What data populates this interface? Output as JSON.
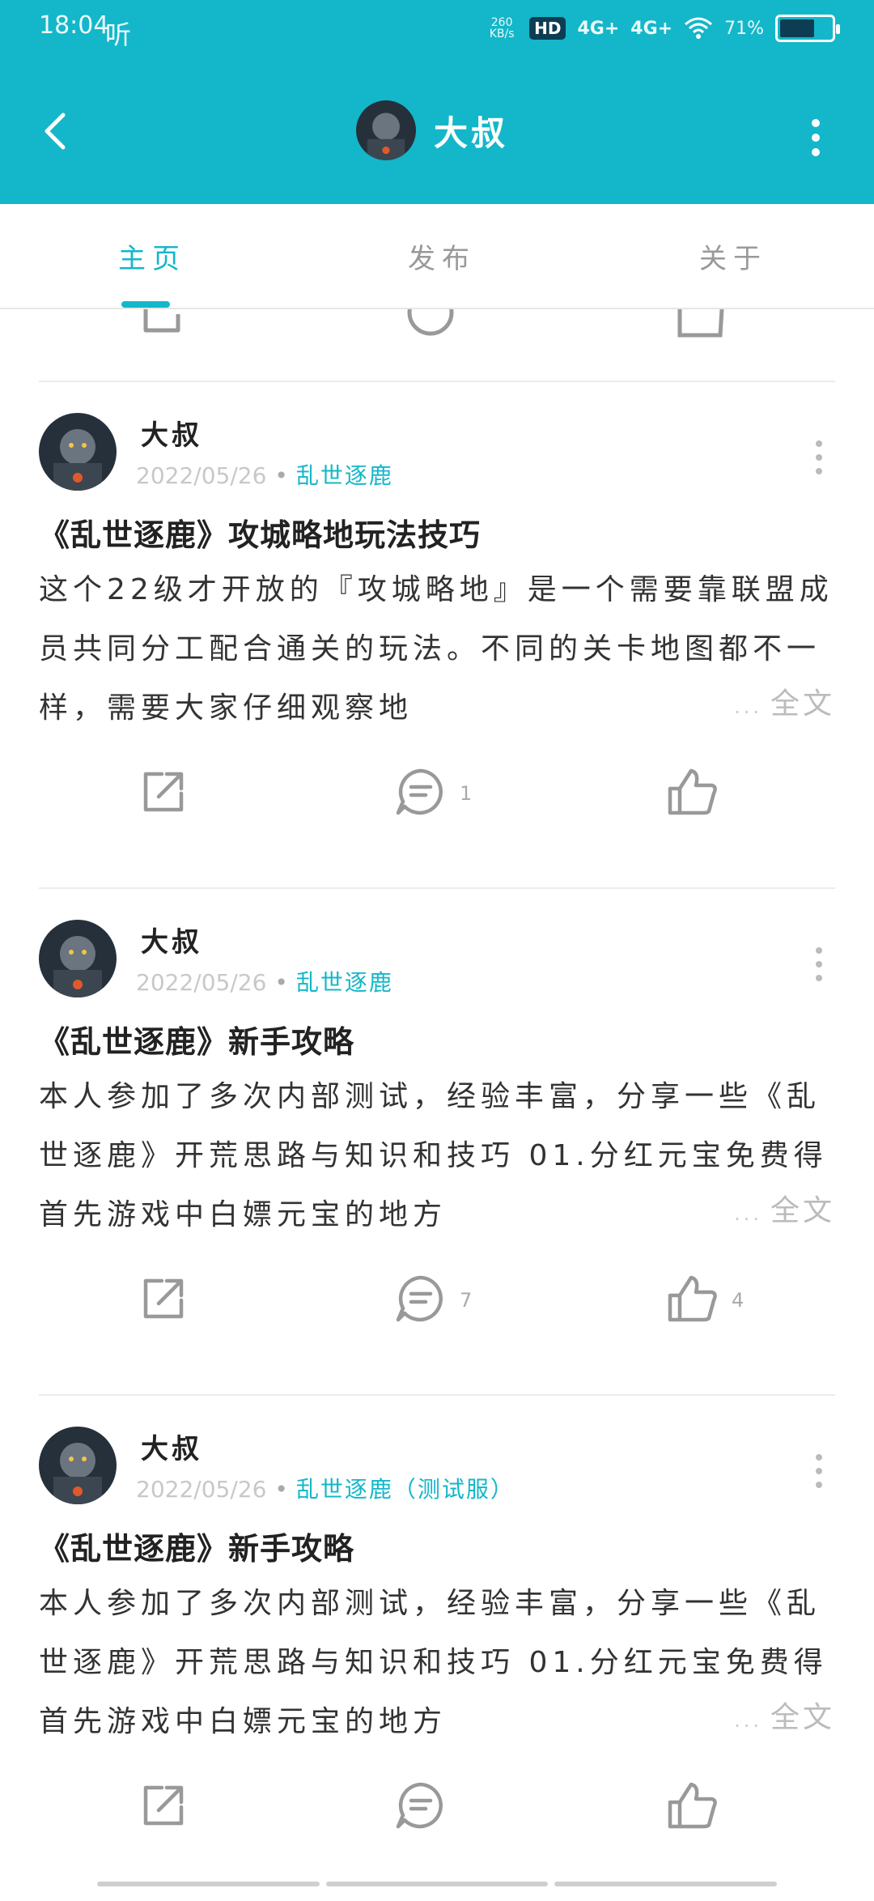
{
  "status": {
    "time": "18:04",
    "extra": "听",
    "speed": "260 KB/s",
    "hd": "HD",
    "net1": "4G+",
    "net2": "4G+",
    "battery_text": "71%",
    "battery_level": 0.71
  },
  "header": {
    "title": "大叔",
    "back_icon": "chevron-left-icon",
    "more_icon": "more-vertical-icon"
  },
  "tabs": [
    {
      "label": "主页",
      "active": true
    },
    {
      "label": "发布",
      "active": false
    },
    {
      "label": "关于",
      "active": false
    }
  ],
  "posts": [
    {
      "author": "大叔",
      "date": "2022/05/26",
      "game": "乱世逐鹿",
      "title": "《乱世逐鹿》攻城略地玩法技巧",
      "body": "这个22级才开放的『攻城略地』是一个需要靠联盟成员共同分工配合通关的玩法。不同的关卡地图都不一样，需要大家仔细观察地",
      "ellipsis": "...",
      "fulltext": "全文",
      "comments": "1",
      "likes": ""
    },
    {
      "author": "大叔",
      "date": "2022/05/26",
      "game": "乱世逐鹿",
      "title": "《乱世逐鹿》新手攻略",
      "body": "本人参加了多次内部测试，经验丰富，分享一些《乱世逐鹿》开荒思路与知识和技巧 01.分红元宝免费得 首先游戏中白嫖元宝的地方",
      "ellipsis": "...",
      "fulltext": "全文",
      "comments": "7",
      "likes": "4"
    },
    {
      "author": "大叔",
      "date": "2022/05/26",
      "game": "乱世逐鹿（测试服）",
      "title": "《乱世逐鹿》新手攻略",
      "body": "本人参加了多次内部测试，经验丰富，分享一些《乱世逐鹿》开荒思路与知识和技巧 01.分红元宝免费得 首先游戏中白嫖元宝的地方",
      "ellipsis": "...",
      "fulltext": "全文",
      "comments": "",
      "likes": ""
    }
  ],
  "colors": {
    "accent": "#13b7c9",
    "text": "#222222",
    "muted": "#c8c8c8"
  }
}
